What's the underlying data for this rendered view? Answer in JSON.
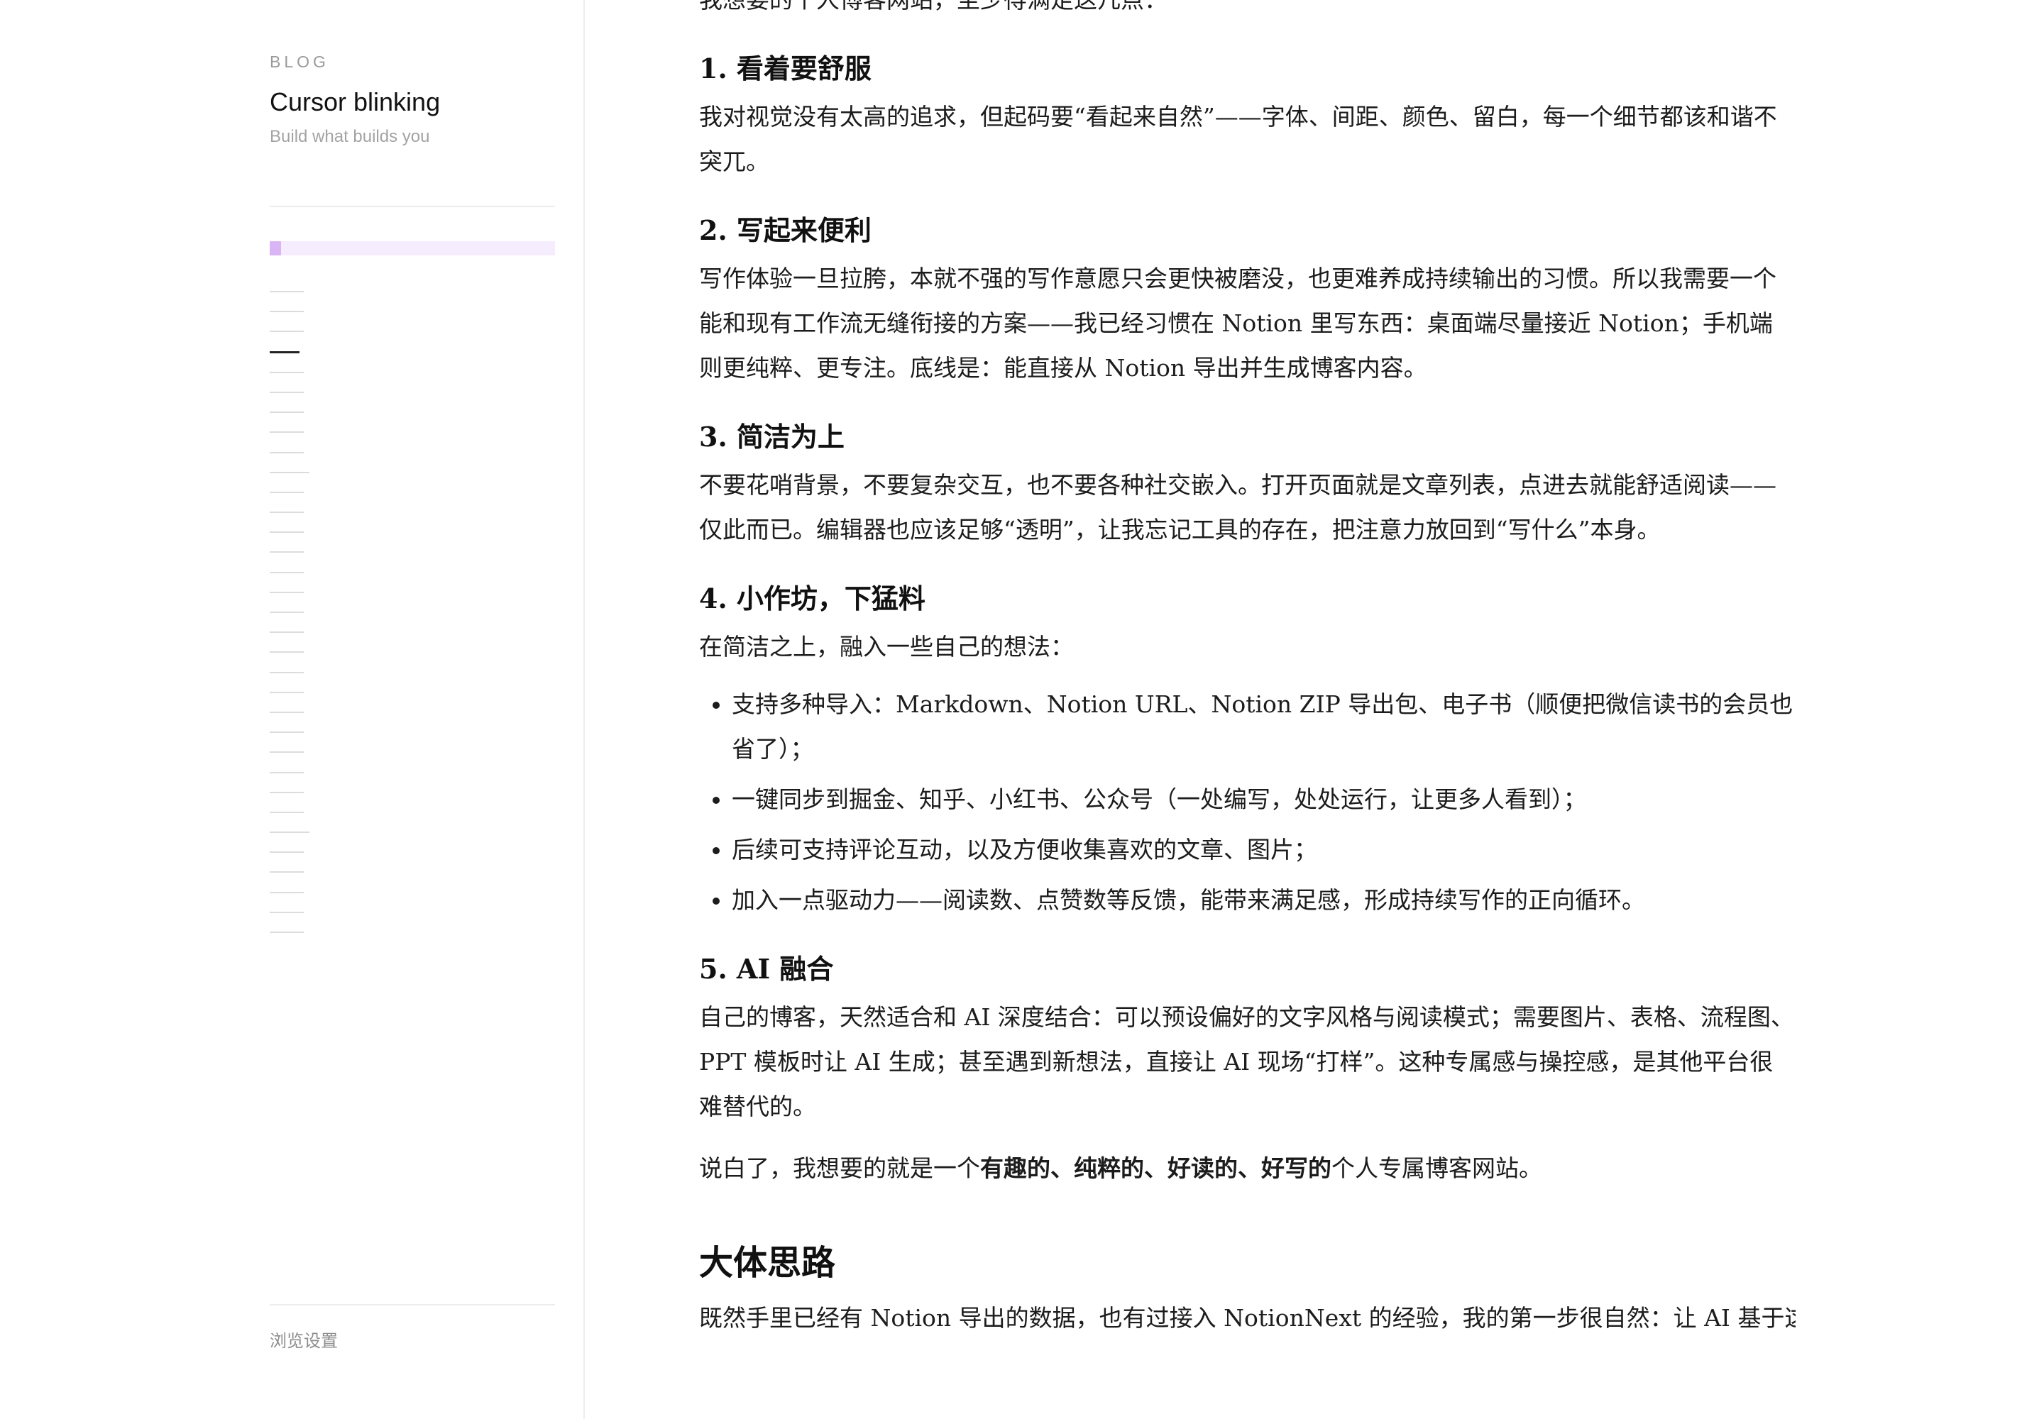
{
  "sidebar": {
    "kicker": "BLOG",
    "title": "Cursor blinking",
    "tagline": "Build what builds you",
    "reading_progress": 0.04,
    "toc_count": 33,
    "toc_active_index": 3,
    "toc_long_indices": [
      9,
      27
    ],
    "settings_label": "浏览设置"
  },
  "article": {
    "intro": "我想要的个人博客网站，至少得满足这几点：",
    "sections": [
      {
        "heading": "1. 看着要舒服",
        "paragraphs": [
          "我对视觉没有太高的追求，但起码要“看起来自然”——字体、间距、颜色、留白，每一个细节都该和谐不突兀。"
        ]
      },
      {
        "heading": "2. 写起来便利",
        "paragraphs": [
          "写作体验一旦拉胯，本就不强的写作意愿只会更快被磨没，也更难养成持续输出的习惯。所以我需要一个能和现有工作流无缝衔接的方案——我已经习惯在 Notion 里写东西：桌面端尽量接近 Notion；手机端则更纯粹、更专注。底线是：能直接从 Notion 导出并生成博客内容。"
        ]
      },
      {
        "heading": "3. 简洁为上",
        "paragraphs": [
          "不要花哨背景，不要复杂交互，也不要各种社交嵌入。打开页面就是文章列表，点进去就能舒适阅读——仅此而已。编辑器也应该足够“透明”，让我忘记工具的存在，把注意力放回到“写什么”本身。"
        ]
      },
      {
        "heading": "4. 小作坊，下猛料",
        "paragraphs": [
          "在简洁之上，融入一些自己的想法："
        ],
        "list": [
          "支持多种导入：Markdown、Notion URL、Notion ZIP 导出包、电子书（顺便把微信读书的会员也省了）；",
          "一键同步到掘金、知乎、小红书、公众号（一处编写，处处运行，让更多人看到）；",
          "后续可支持评论互动，以及方便收集喜欢的文章、图片；",
          "加入一点驱动力——阅读数、点赞数等反馈，能带来满足感，形成持续写作的正向循环。"
        ]
      },
      {
        "heading": "5. AI 融合",
        "paragraphs": [
          "自己的博客，天然适合和 AI 深度结合：可以预设偏好的文字风格与阅读模式；需要图片、表格、流程图、PPT 模板时让 AI 生成；甚至遇到新想法，直接让 AI 现场“打样”。这种专属感与操控感，是其他平台很难替代的。"
        ]
      }
    ],
    "summary_before": "说白了，我想要的就是一个",
    "summary_bold": "有趣的、纯粹的、好读的、好写的",
    "summary_after": "个人专属博客网站。",
    "next_heading": "大体思路",
    "next_paragraph": "既然手里已经有 Notion 导出的数据，也有过接入 NotionNext 的经验，我的第一步很自然：让 AI 基于这"
  }
}
